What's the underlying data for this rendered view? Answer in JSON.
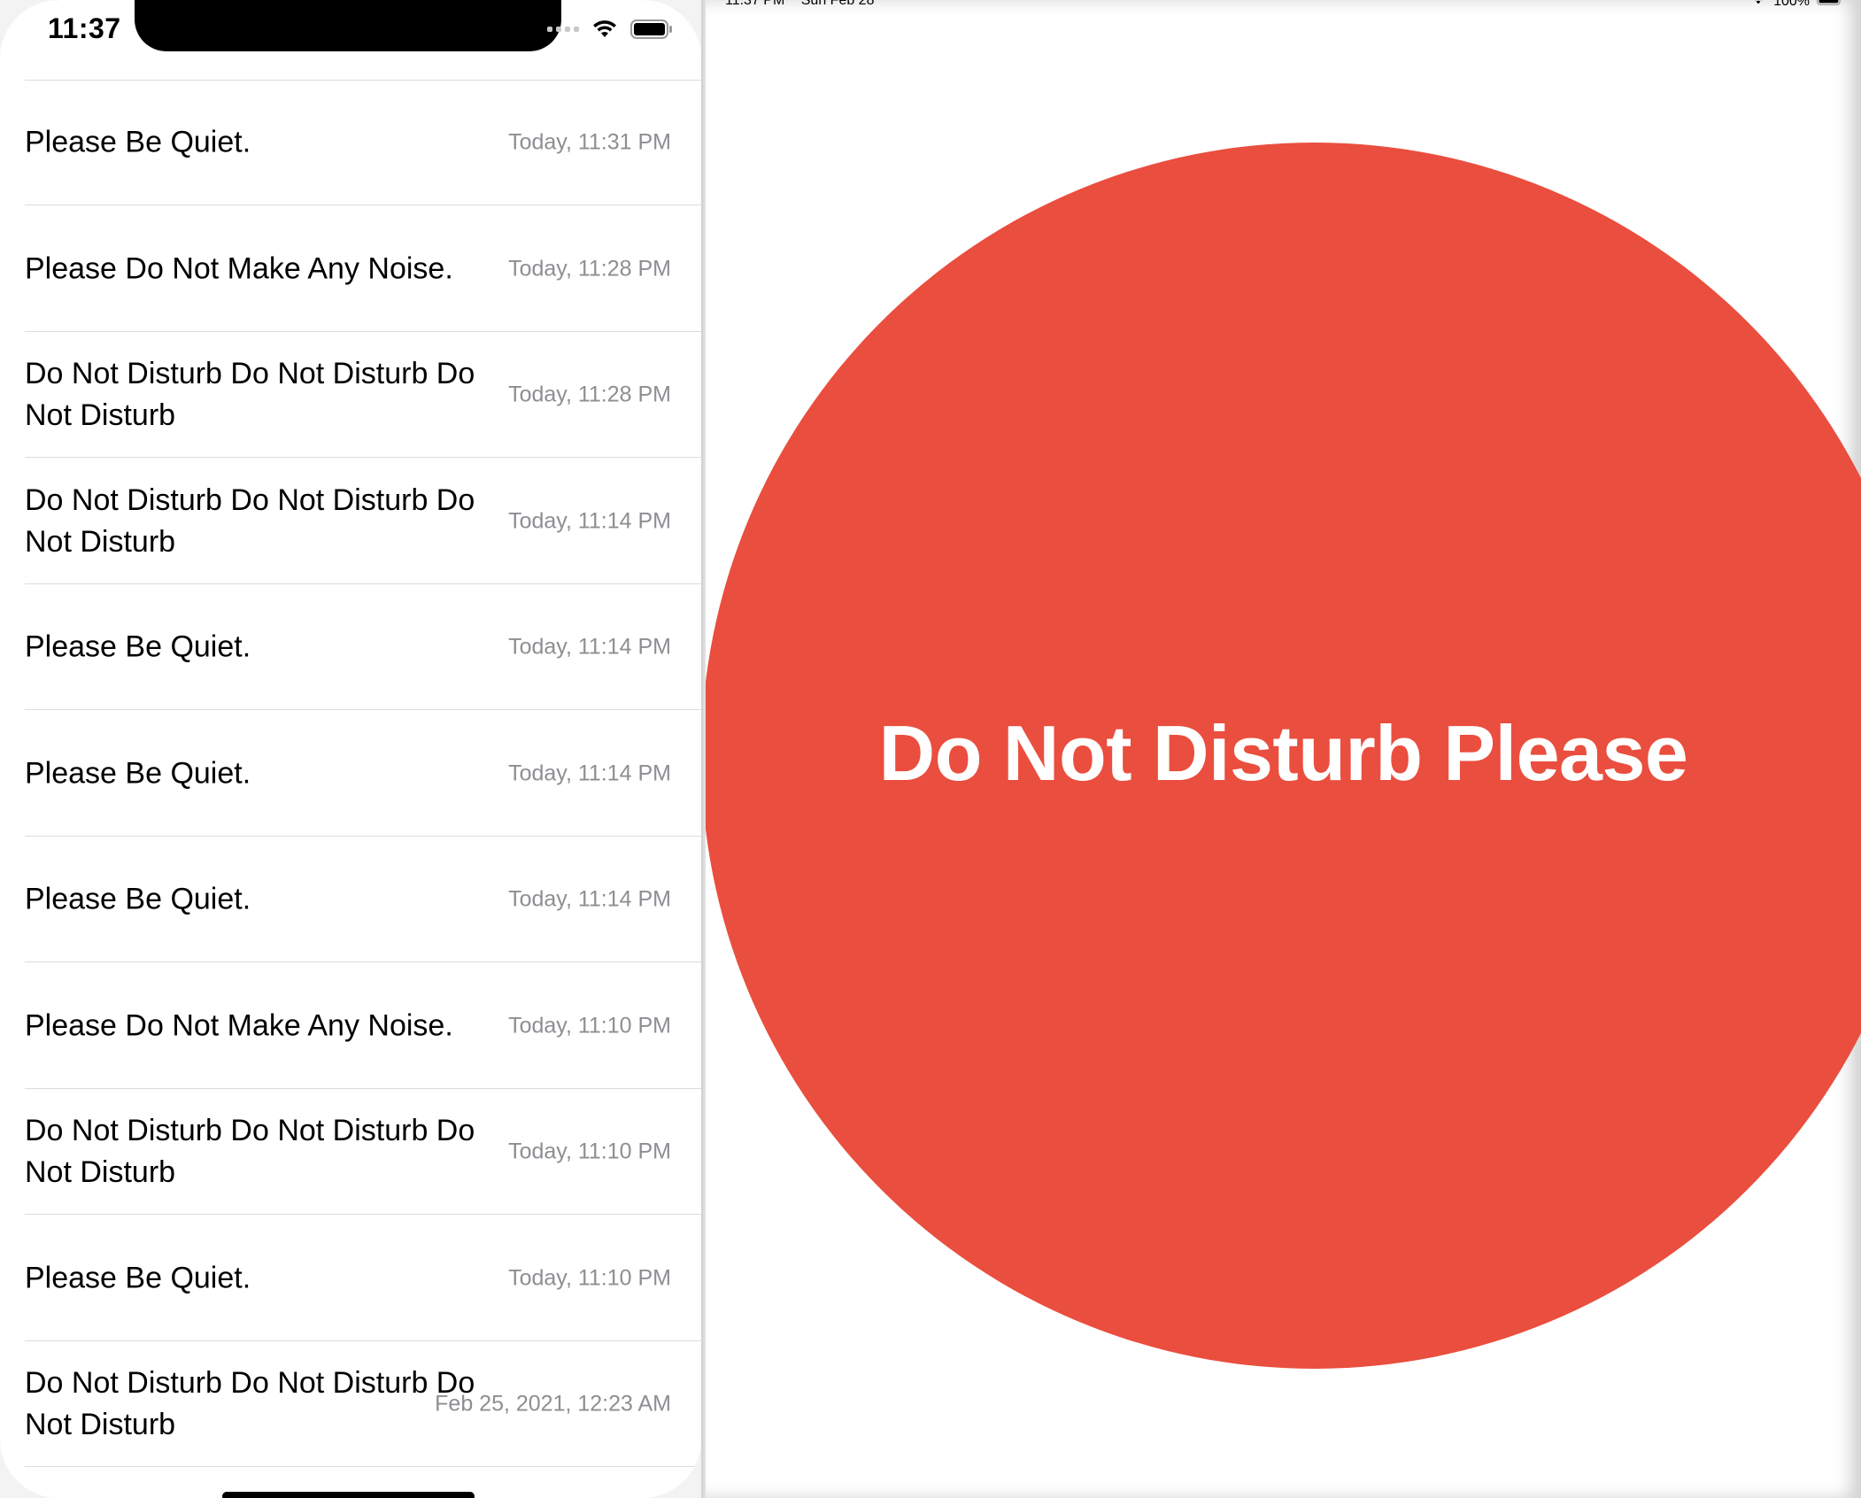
{
  "phone": {
    "status_time": "11:37",
    "messages": [
      {
        "text": "Please Be Quiet.",
        "date": "Today, 11:31 PM"
      },
      {
        "text": "Please Do Not Make Any Noise.",
        "date": "Today, 11:28 PM"
      },
      {
        "text": "Do Not Disturb Do Not Disturb Do Not Disturb",
        "date": "Today, 11:28 PM"
      },
      {
        "text": "Do Not Disturb Do Not Disturb Do Not Disturb",
        "date": "Today, 11:14 PM"
      },
      {
        "text": "Please Be Quiet.",
        "date": "Today, 11:14 PM"
      },
      {
        "text": "Please Be Quiet.",
        "date": "Today, 11:14 PM"
      },
      {
        "text": "Please Be Quiet.",
        "date": "Today, 11:14 PM"
      },
      {
        "text": "Please Do Not Make Any Noise.",
        "date": "Today, 11:10 PM"
      },
      {
        "text": "Do Not Disturb Do Not Disturb Do Not Disturb",
        "date": "Today, 11:10 PM"
      },
      {
        "text": "Please Be Quiet.",
        "date": "Today, 11:10 PM"
      },
      {
        "text": "Do Not Disturb Do Not Disturb Do Not Disturb",
        "date": "Feb 25, 2021, 12:23 AM"
      }
    ]
  },
  "ipad": {
    "status_time": "11:37 PM",
    "status_date": "Sun Feb 28",
    "battery_percent": "100%",
    "display_text": "Do Not Disturb Please",
    "circle_color": "#ea4e3e"
  },
  "icons": {
    "wifi": "wifi-icon",
    "battery": "battery-icon",
    "signal": "cellular-signal-icon"
  }
}
